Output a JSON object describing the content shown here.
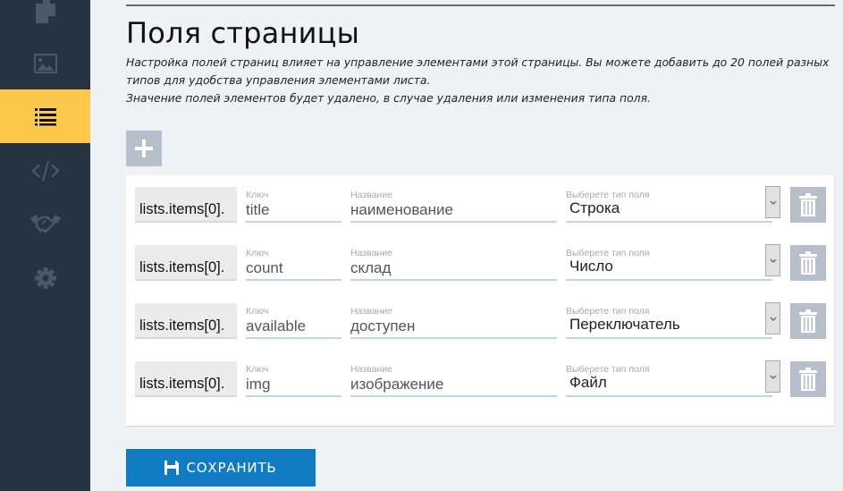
{
  "sidebar": {
    "items": [
      {
        "icon": "files-icon",
        "active": false
      },
      {
        "icon": "image-icon",
        "active": false
      },
      {
        "icon": "list-icon",
        "active": true
      },
      {
        "icon": "code-icon",
        "active": false
      },
      {
        "icon": "handshake-icon",
        "active": false
      },
      {
        "icon": "gear-icon",
        "active": false
      }
    ],
    "colors": {
      "background": "#273340",
      "active": "#fdc94d",
      "icon": "#4b5867"
    }
  },
  "page": {
    "title": "Поля страницы",
    "description_line1": "Настройка полей страниц влияет на управление элементами этой страницы. Вы можете добавить до 20 полей разных типов для удобства управления элементами листа.",
    "description_line2": "Значение полей элементов будет удалено, в случае удаления или изменения типа поля."
  },
  "toolbar": {
    "add_icon": "plus-icon"
  },
  "fields": {
    "key_label": "Ключ",
    "name_label": "Название",
    "type_label": "Выберете тип поля",
    "rows": [
      {
        "prefix": "lists.items[0].",
        "key": "title",
        "name": "наименование",
        "type": "Строка"
      },
      {
        "prefix": "lists.items[0].",
        "key": "count",
        "name": "склад",
        "type": "Число"
      },
      {
        "prefix": "lists.items[0].",
        "key": "available",
        "name": "доступен",
        "type": "Переключатель"
      },
      {
        "prefix": "lists.items[0].",
        "key": "img",
        "name": "изображение",
        "type": "Файл"
      }
    ]
  },
  "actions": {
    "save_label": "СОХРАНИТЬ",
    "save_icon": "floppy-disk-icon",
    "save_color": "#107bc2"
  }
}
